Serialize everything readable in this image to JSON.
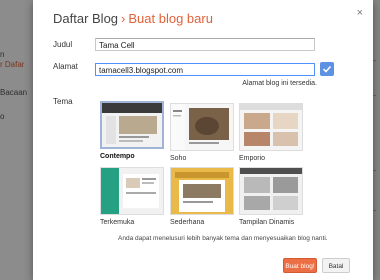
{
  "background": {
    "items": [
      {
        "label": "r Dafar",
        "color": "orange"
      },
      {
        "label": "n",
        "color": "gray"
      },
      {
        "label": "Bacaan",
        "color": "gray"
      },
      {
        "label": "o",
        "color": "gray"
      }
    ]
  },
  "dialog": {
    "breadcrumb_parent": "Daftar Blog",
    "breadcrumb_separator": "›",
    "title": "Buat blog baru",
    "close_icon": "×",
    "form": {
      "title_label": "Judul",
      "title_value": "Tama Cell",
      "address_label": "Alamat",
      "address_value": "tamacell3.blogspot.com",
      "address_hint": "Alamat blog ini tersedia.",
      "theme_label": "Tema"
    },
    "themes": [
      {
        "name": "Contempo",
        "selected": true
      },
      {
        "name": "Soho",
        "selected": false
      },
      {
        "name": "Emporio",
        "selected": false
      },
      {
        "name": "Terkemuka",
        "selected": false
      },
      {
        "name": "Sederhana",
        "selected": false
      },
      {
        "name": "Tampilan Dinamis",
        "selected": false
      }
    ],
    "footer_note": "Anda dapat menelusuri lebih banyak tema dan menyesuaikan blog nanti.",
    "create_button": "Buat blog!",
    "cancel_button": "Batal"
  },
  "colors": {
    "accent": "#e0623a",
    "primary_button": "#ec6e45",
    "check_button": "#5d91e4"
  }
}
